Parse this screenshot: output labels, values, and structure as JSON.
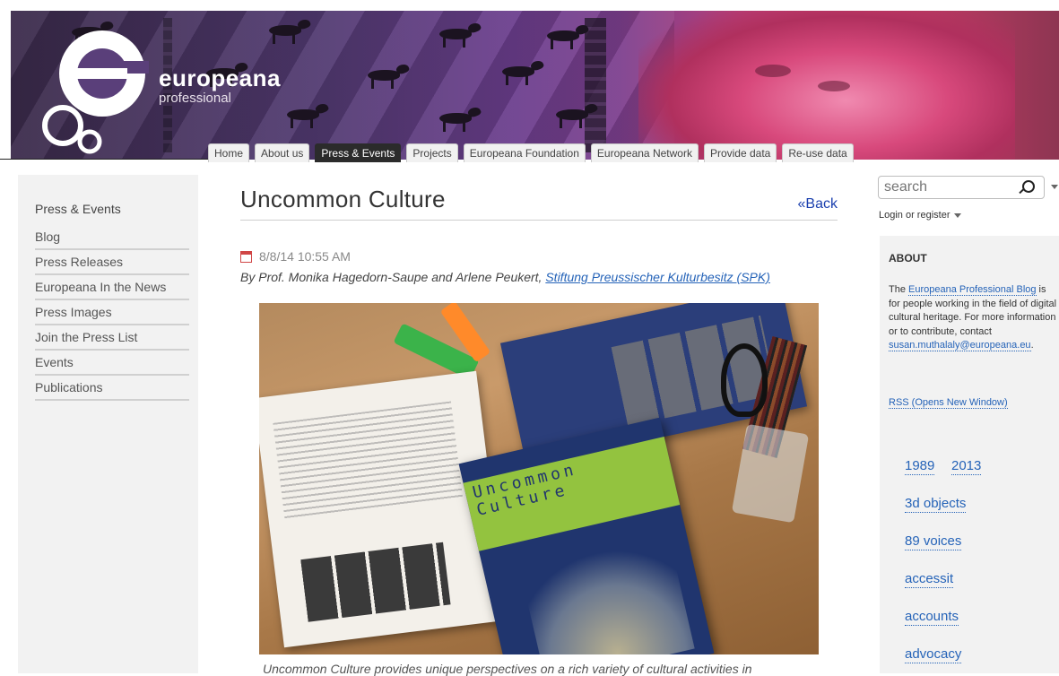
{
  "brand": {
    "name": "europeana",
    "tagline": "professional"
  },
  "nav": {
    "tabs": [
      {
        "label": "Home"
      },
      {
        "label": "About us"
      },
      {
        "label": "Press & Events",
        "active": true
      },
      {
        "label": "Projects"
      },
      {
        "label": "Europeana Foundation"
      },
      {
        "label": "Europeana Network"
      },
      {
        "label": "Provide data"
      },
      {
        "label": "Re-use data"
      }
    ]
  },
  "sidebar": {
    "heading": "Press & Events",
    "items": [
      {
        "label": "Blog"
      },
      {
        "label": "Press Releases"
      },
      {
        "label": "Europeana In the News"
      },
      {
        "label": "Press Images"
      },
      {
        "label": "Join the Press List"
      },
      {
        "label": "Events"
      },
      {
        "label": "Publications"
      }
    ]
  },
  "article": {
    "title": "Uncommon Culture",
    "back_label": "«Back",
    "date": "8/8/14 10:55 AM",
    "byline_prefix": "By Prof. Monika Hagedorn-Saupe and Arlene Peukert, ",
    "byline_link": "Stiftung Preussischer Kulturbesitz (SPK)",
    "photo_text": {
      "cover_word_1": "Uncommon",
      "cover_word_2": "Culture"
    },
    "caption": "Uncommon Culture provides unique perspectives on a rich variety of cultural activities in"
  },
  "search": {
    "placeholder": "search"
  },
  "login": {
    "label": "Login or register"
  },
  "about": {
    "heading": "ABOUT",
    "text_1": "The ",
    "link_1": "Europeana Professional Blog",
    "text_2": " is for people working in the field of digital cultural heritage. For more information or to contribute, contact ",
    "email": "susan.muthalaly@europeana.eu",
    "text_3": ".",
    "rss_label": "RSS",
    "rss_suffix": " (Opens New Window)"
  },
  "tags": [
    "1989",
    "2013",
    "3d objects",
    "89 voices",
    "accessit",
    "accounts",
    "advocacy"
  ],
  "colors": {
    "accent_link": "#2563b8",
    "active_tab": "#2b2b2b",
    "calendar_red": "#d04545"
  }
}
